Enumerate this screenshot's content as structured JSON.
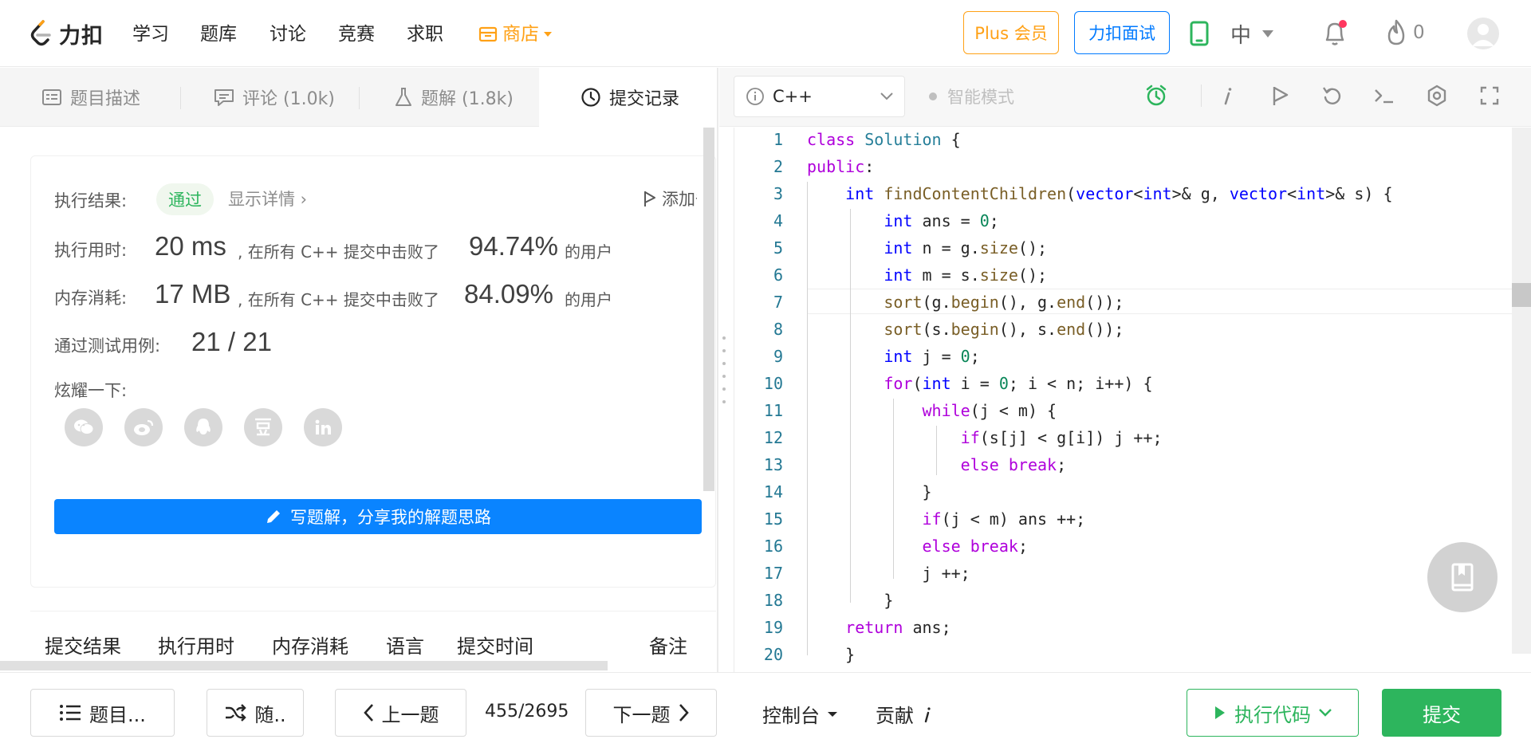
{
  "brand": {
    "logo_text": "力扣",
    "accent": "#ffa116"
  },
  "nav": {
    "items": [
      "学习",
      "题库",
      "讨论",
      "竞赛",
      "求职"
    ],
    "shop_label": "商店",
    "plus_label": "Plus 会员",
    "interview_label": "力扣面试",
    "lang_label": "中",
    "fire_count": "0"
  },
  "left_tabs": {
    "description": "题目描述",
    "comments": "评论 (1.0k)",
    "solutions": "题解 (1.8k)",
    "submissions": "提交记录"
  },
  "result": {
    "status_label": "执行结果:",
    "status_value": "通过",
    "show_details": "显示详情 ›",
    "add_note": "添加备注",
    "runtime_label": "执行用时:",
    "runtime_value": "20 ms",
    "runtime_mid": ", 在所有 C++ 提交中击败了",
    "runtime_pct": "94.74%",
    "runtime_suffix": "的用户",
    "memory_label": "内存消耗:",
    "memory_value": "17 MB",
    "memory_mid": ", 在所有 C++ 提交中击败了",
    "memory_pct": "84.09%",
    "memory_suffix": "的用户",
    "tests_label": "通过测试用例:",
    "tests_value": "21 / 21",
    "share_label": "炫耀一下:",
    "share_icons": [
      "wechat-icon",
      "weibo-icon",
      "qq-icon",
      "douban-icon",
      "linkedin-icon"
    ],
    "write_solution": "写题解，分享我的解题思路"
  },
  "table": {
    "headers": [
      "提交结果",
      "执行用时",
      "内存消耗",
      "语言",
      "提交时间",
      "备注"
    ]
  },
  "editor": {
    "language": "C++",
    "mode_label": "智能模式",
    "line_numbers": [
      "1",
      "2",
      "3",
      "4",
      "5",
      "6",
      "7",
      "8",
      "9",
      "10",
      "11",
      "12",
      "13",
      "14",
      "15",
      "16",
      "17",
      "18",
      "19",
      "20"
    ],
    "code_lines": [
      "class Solution {",
      "public:",
      "    int findContentChildren(vector<int>& g, vector<int>& s) {",
      "        int ans = 0;",
      "        int n = g.size();",
      "        int m = s.size();",
      "        sort(g.begin(), g.end());",
      "        sort(s.begin(), s.end());",
      "        int j = 0;",
      "        for(int i = 0; i < n; i++) {",
      "            while(j < m) {",
      "                if(s[j] < g[i]) j ++;",
      "                else break;",
      "            }",
      "            if(j < m) ans ++;",
      "            else break;",
      "            j ++;",
      "        }",
      "    return ans;",
      "    }"
    ]
  },
  "bottom": {
    "problem_list": "题目...",
    "random": "随..",
    "prev": "上一题",
    "page_count": "455/2695",
    "next": "下一题",
    "console": "控制台",
    "contribute": "贡献",
    "run": "执行代码",
    "submit": "提交"
  },
  "colors": {
    "pass_green": "#2db55d",
    "link_blue": "#007aff",
    "write_btn": "#0a84ff"
  }
}
